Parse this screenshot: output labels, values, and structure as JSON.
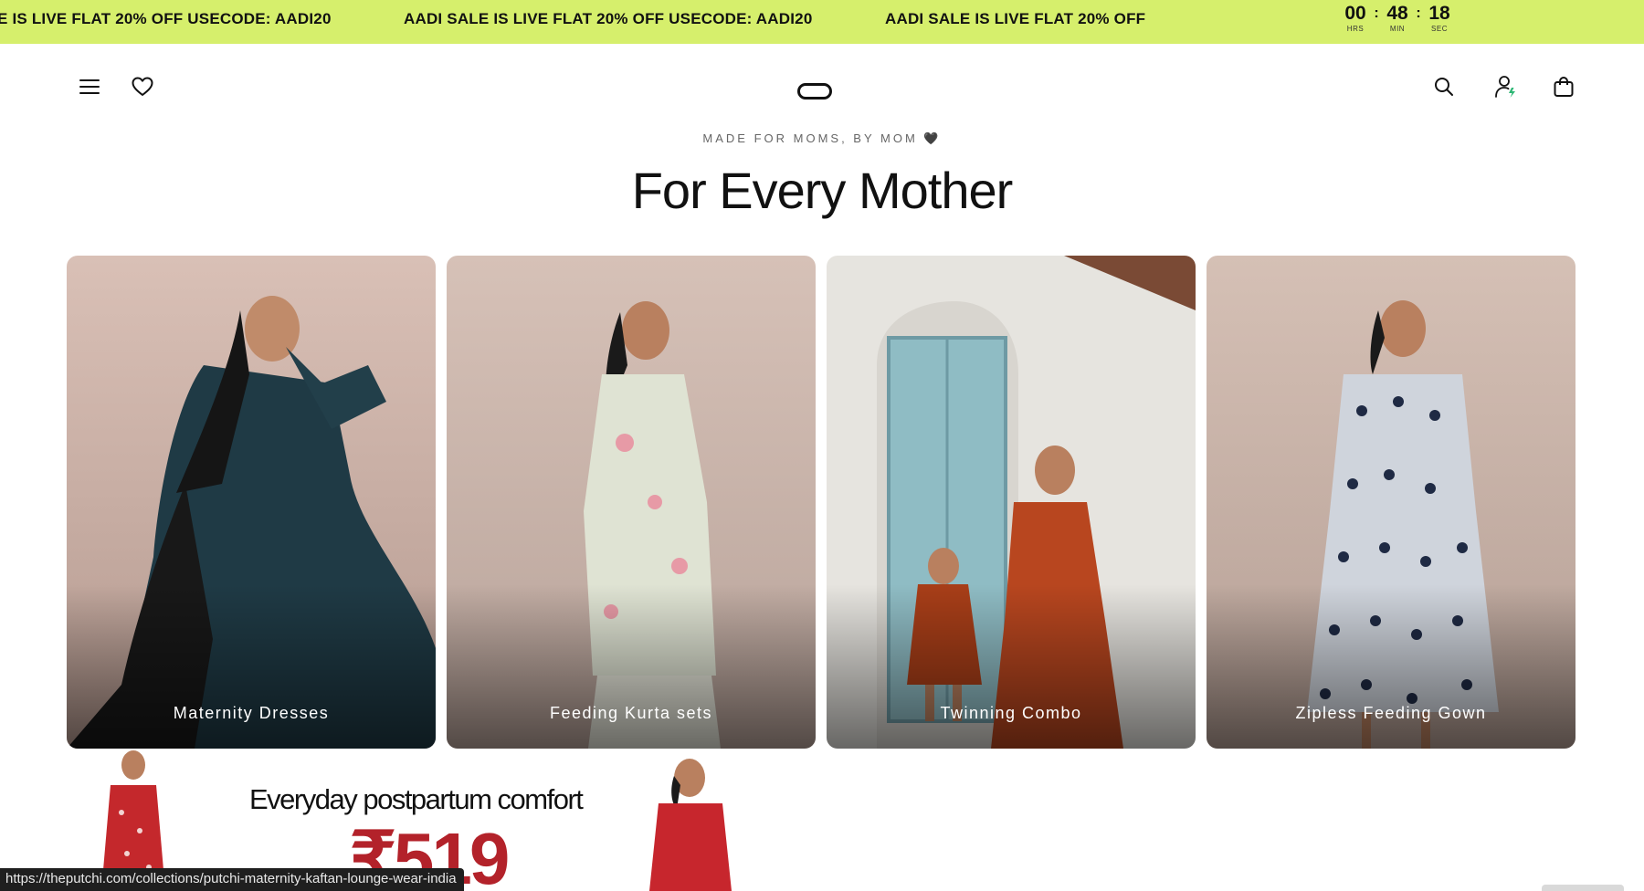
{
  "announcement": {
    "segments": [
      "E IS LIVE FLAT 20% OFF USECODE: AADI20",
      "AADI SALE IS LIVE FLAT 20% OFF USECODE: AADI20",
      "AADI SALE IS LIVE FLAT 20% OFF"
    ],
    "countdown": {
      "hours": "00",
      "hours_label": "HRS",
      "minutes": "48",
      "minutes_label": "MIN",
      "seconds": "18",
      "seconds_label": "SEC",
      "separator": ":"
    },
    "background": "#d6ef6c"
  },
  "header": {
    "icons": [
      "menu-icon",
      "heart-icon",
      "logo",
      "search-icon",
      "account-icon",
      "bag-icon"
    ]
  },
  "section": {
    "eyebrow": "MADE FOR MOMS, BY MOM 🖤",
    "title": "For Every Mother"
  },
  "categories": [
    {
      "label": "Maternity Dresses"
    },
    {
      "label": "Feeding Kurta sets"
    },
    {
      "label": "Twinning Combo"
    },
    {
      "label": "Zipless Feeding Gown"
    }
  ],
  "promo": {
    "headline": "Everyday postpartum comfort",
    "price": "₹519",
    "price_color": "#b3222a"
  },
  "status_bar": {
    "url": "https://theputchi.com/collections/putchi-maternity-kaftan-lounge-wear-india"
  }
}
